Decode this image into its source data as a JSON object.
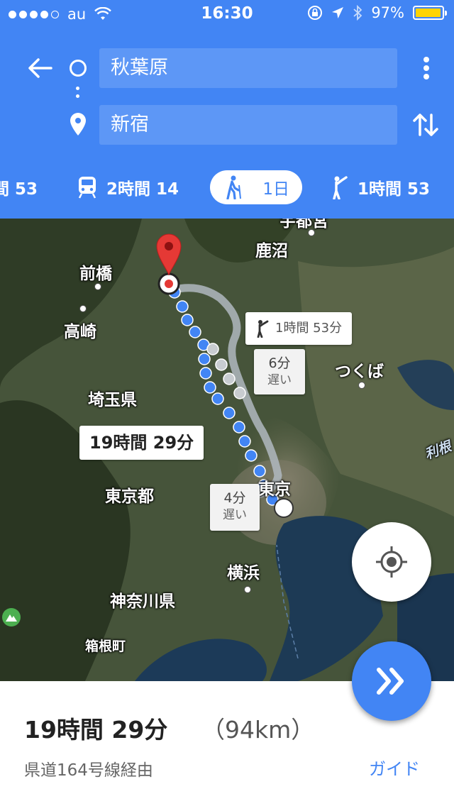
{
  "status_bar": {
    "carrier": "au",
    "time": "16:30",
    "battery": "97%"
  },
  "directions": {
    "origin": "秋葉原",
    "destination": "新宿"
  },
  "modes": [
    {
      "name": "car",
      "label": "間 53",
      "selected": false
    },
    {
      "name": "transit",
      "label": "2時間 14",
      "selected": false
    },
    {
      "name": "walk",
      "label": "1日",
      "selected": true
    },
    {
      "name": "ride",
      "label": "1時間 53",
      "selected": false
    }
  ],
  "map": {
    "places": {
      "utsunomiya": "宇都宮",
      "kanuma": "鹿沼",
      "maebashi": "前橋",
      "takasaki": "高崎",
      "saitama_ken": "埼玉県",
      "tsukuba": "つくば",
      "tokyo_to": "東京都",
      "tokyo": "東京",
      "yokohama": "横浜",
      "kanagawa_ken": "神奈川県",
      "hakone": "箱根町",
      "kasumigaura": "利根"
    },
    "callouts": {
      "main_duration": "19時間 29分",
      "alt_walk": "1時間 53分",
      "late_a_time": "6分",
      "late_a_label": "遅い",
      "late_b_time": "4分",
      "late_b_label": "遅い"
    }
  },
  "summary": {
    "duration": "19時間 29分",
    "distance": "（94km）",
    "via": "県道164号線経由",
    "guide_label": "ガイド"
  },
  "colors": {
    "primary": "#4285f4",
    "route_primary": "#4285f4",
    "route_alt": "#b0b8c0",
    "pin": "#e53935"
  }
}
